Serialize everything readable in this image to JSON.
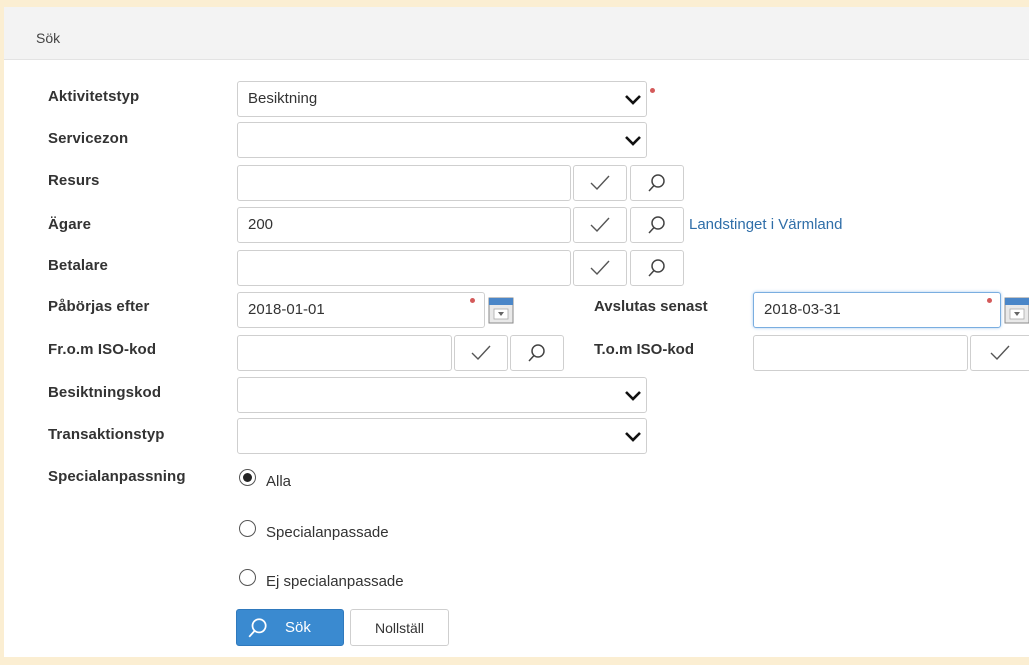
{
  "panel": {
    "title": "Sök"
  },
  "labels": {
    "aktivitetstyp": "Aktivitetstyp",
    "servicezon": "Servicezon",
    "resurs": "Resurs",
    "agare": "Ägare",
    "betalare": "Betalare",
    "paborjas_efter": "Påbörjas efter",
    "avslutas_senast": "Avslutas senast",
    "from_iso": "Fr.o.m ISO-kod",
    "tom_iso": "T.o.m ISO-kod",
    "besiktningskod": "Besiktningskod",
    "transaktionstyp": "Transaktionstyp",
    "specialanpassning": "Specialanpassning"
  },
  "fields": {
    "aktivitetstyp": "Besiktning",
    "servicezon": "",
    "resurs": "",
    "agare": "200",
    "agare_name": "Landstinget i Värmland",
    "betalare": "",
    "paborjas_efter": "2018-01-01",
    "avslutas_senast": "2018-03-31",
    "from_iso": "",
    "tom_iso": "",
    "besiktningskod": "",
    "transaktionstyp": ""
  },
  "radio": {
    "selected": "Alla",
    "options": [
      "Alla",
      "Specialanpassade",
      "Ej specialanpassade"
    ]
  },
  "buttons": {
    "search": "Sök",
    "reset": "Nollställ"
  },
  "colors": {
    "accent": "#3a8ad0",
    "required": "#d45a5a",
    "link": "#2f6ea8",
    "frame": "#fbeed2"
  }
}
